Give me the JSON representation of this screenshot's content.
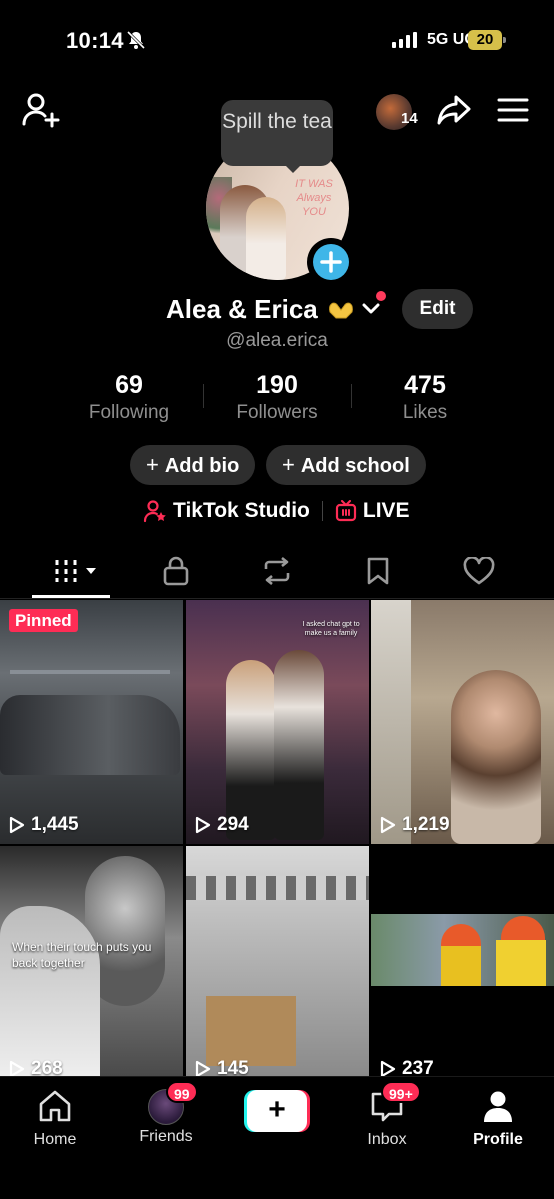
{
  "status": {
    "time": "10:14",
    "network": "5G UC",
    "battery": "20"
  },
  "header": {
    "visitor_count": "14",
    "tooltip": "Spill the tea"
  },
  "profile": {
    "name": "Alea & Erica",
    "handle": "@alea.erica",
    "edit_label": "Edit",
    "avatar_sign_text": "IT WAS Always YOU",
    "stats": [
      {
        "value": "69",
        "label": "Following"
      },
      {
        "value": "190",
        "label": "Followers"
      },
      {
        "value": "475",
        "label": "Likes"
      }
    ],
    "add_bio": "Add bio",
    "add_school": "Add school",
    "studio": "TikTok Studio",
    "live": "LIVE"
  },
  "tabs": [
    {
      "name": "videos",
      "icon": "grid-icon"
    },
    {
      "name": "private",
      "icon": "lock-icon"
    },
    {
      "name": "reposts",
      "icon": "repost-icon"
    },
    {
      "name": "favorites",
      "icon": "bookmark-icon"
    },
    {
      "name": "liked",
      "icon": "heart-icon"
    }
  ],
  "videos": [
    {
      "views": "1,445",
      "pinned": "Pinned",
      "overlay": ""
    },
    {
      "views": "294",
      "pinned": "",
      "overlay": "I asked chat gpt to make us a family"
    },
    {
      "views": "1,219",
      "pinned": "",
      "overlay": ""
    },
    {
      "views": "268",
      "pinned": "",
      "overlay": "When their touch puts you back together"
    },
    {
      "views": "145",
      "pinned": "",
      "overlay": ""
    },
    {
      "views": "237",
      "pinned": "",
      "overlay": ""
    }
  ],
  "bottom_nav": {
    "home": "Home",
    "friends": "Friends",
    "friends_badge": "99",
    "inbox": "Inbox",
    "inbox_badge": "99+",
    "profile": "Profile"
  },
  "colors": {
    "accent": "#fe2c55",
    "cyan": "#25f4ee",
    "avatar_plus": "#3fb6e8"
  }
}
